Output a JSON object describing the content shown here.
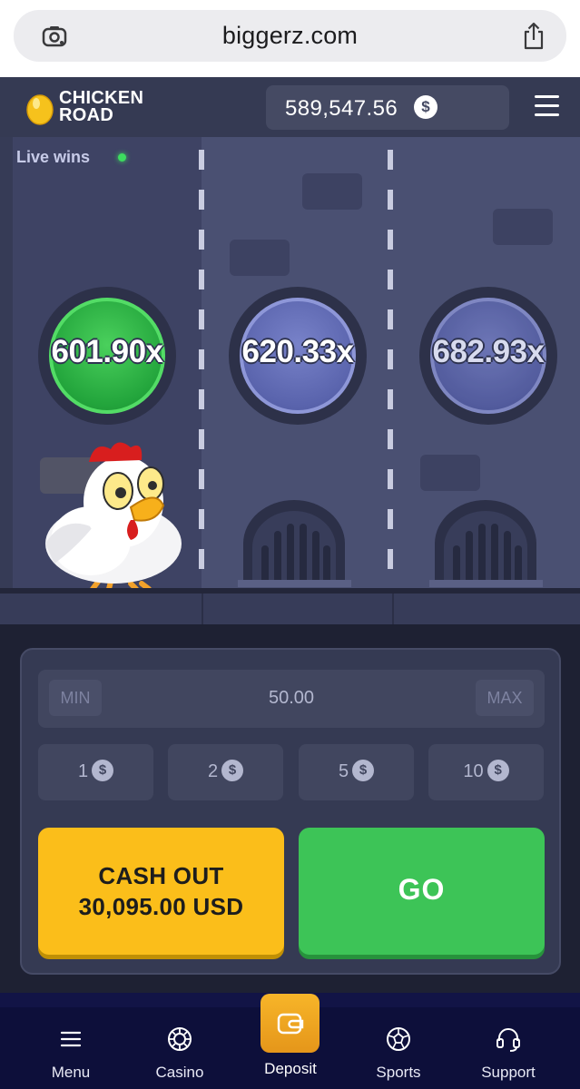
{
  "browser": {
    "url": "biggerz.com"
  },
  "header": {
    "logo_line1": "CHICKEN",
    "logo_line2": "ROAD",
    "balance": "589,547.56",
    "currency_symbol": "$"
  },
  "game": {
    "live_wins_label": "Live wins",
    "multipliers": [
      {
        "value": "601.90x",
        "state": "passed"
      },
      {
        "value": "620.33x",
        "state": "next"
      },
      {
        "value": "682.93x",
        "state": "upcoming"
      }
    ]
  },
  "controls": {
    "min_label": "MIN",
    "max_label": "MAX",
    "bet_value": "50.00",
    "chips": [
      {
        "amount": "1",
        "symbol": "$"
      },
      {
        "amount": "2",
        "symbol": "$"
      },
      {
        "amount": "5",
        "symbol": "$"
      },
      {
        "amount": "10",
        "symbol": "$"
      }
    ],
    "cashout_line1": "CASH OUT",
    "cashout_line2": "30,095.00 USD",
    "go_label": "GO"
  },
  "bottom_nav": {
    "items": [
      {
        "label": "Menu",
        "icon": "menu-icon"
      },
      {
        "label": "Casino",
        "icon": "casino-chip-icon"
      },
      {
        "label": "Deposit",
        "icon": "wallet-icon"
      },
      {
        "label": "Sports",
        "icon": "soccer-ball-icon"
      },
      {
        "label": "Support",
        "icon": "headset-icon"
      }
    ]
  },
  "colors": {
    "accent_yellow": "#fbbe1a",
    "accent_green": "#3dc457",
    "win_green": "#23a53c",
    "multiplier_blue": "#5a64ad",
    "nav_bg": "#0d0f3a"
  }
}
